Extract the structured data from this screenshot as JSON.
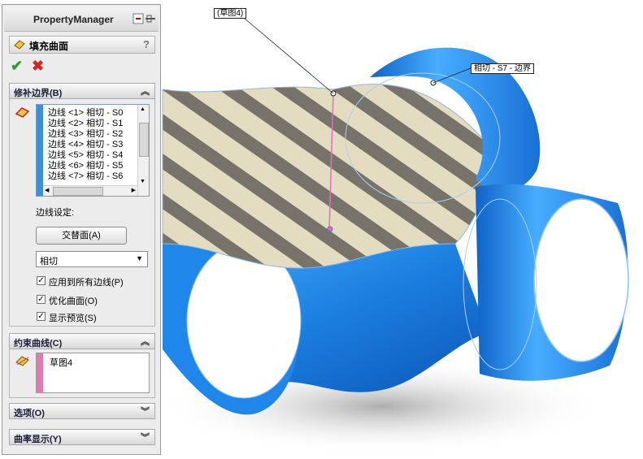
{
  "property_manager": {
    "title": "PropertyManager",
    "feature_name": "填充曲面",
    "help_icon": "?",
    "ok_icon": "check-icon",
    "cancel_icon": "close-icon"
  },
  "patch_boundary": {
    "header": "修补边界(B)",
    "edges": [
      "边线 <1> 相切 - S0",
      "边线 <2> 相切 - S1",
      "边线 <3> 相切 - S2",
      "边线 <4> 相切 - S3",
      "边线 <5> 相切 - S4",
      "边线 <6> 相切 - S5",
      "边线 <7> 相切 - S6"
    ],
    "edge_settings_label": "边线设定:",
    "alternate_face_button": "交替面(A)",
    "contact_type": "相切",
    "apply_all_edges": "应用到所有边线(P)",
    "optimize_surface": "优化曲面(O)",
    "show_preview": "显示预览(S)"
  },
  "constraint_curves": {
    "header": "约束曲线(C)",
    "items": [
      "草图4"
    ]
  },
  "options": {
    "header": "选项(O)"
  },
  "curvature_display": {
    "header": "曲率显示(Y)"
  },
  "annotations": {
    "sketch_label": "(草图4)",
    "tangent_label": "相切 - S7 - 边界"
  },
  "colors": {
    "tube_blue": "#1e8ee8",
    "stripe_blue": "#3b8fd9",
    "stripe_pink": "#e07ab0"
  }
}
